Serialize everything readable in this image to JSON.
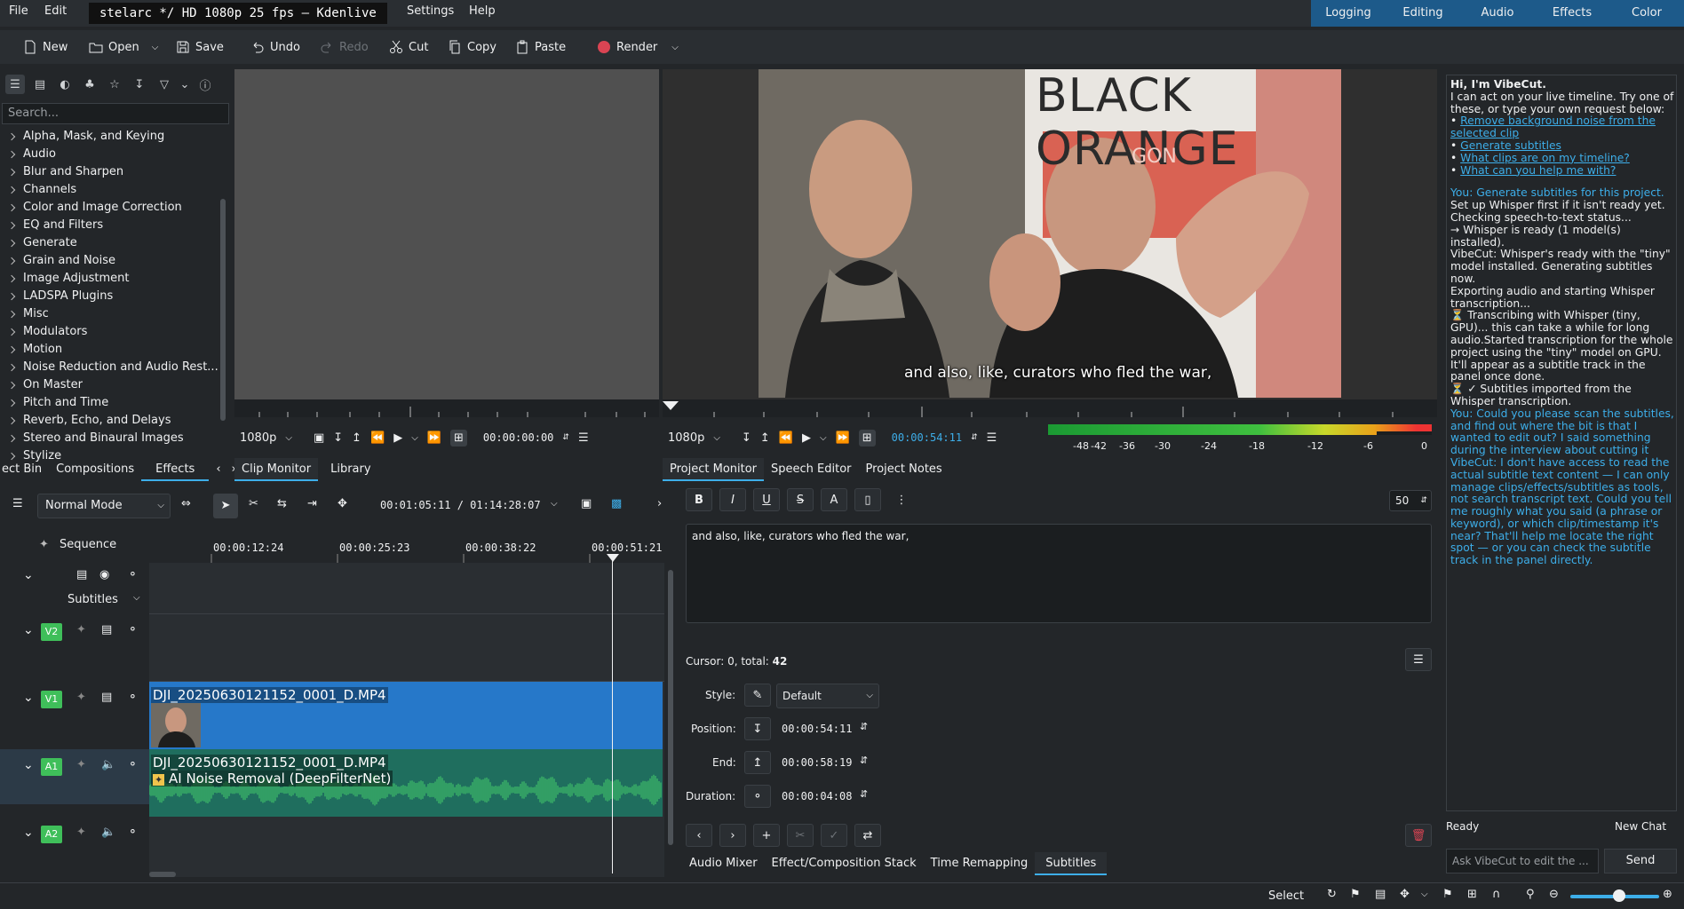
{
  "menu": {
    "items": [
      "File",
      "Edit",
      "Settings",
      "Help"
    ],
    "window_title": "stelarc */ HD 1080p 25 fps — Kdenlive"
  },
  "workspaces": [
    "Logging",
    "Editing",
    "Audio",
    "Effects",
    "Color"
  ],
  "toolbar": {
    "new": "New",
    "open": "Open",
    "save": "Save",
    "undo": "Undo",
    "redo": "Redo",
    "cut": "Cut",
    "copy": "Copy",
    "paste": "Paste",
    "render": "Render"
  },
  "effects": {
    "search_placeholder": "Search...",
    "categories": [
      "Alpha, Mask, and Keying",
      "Audio",
      "Blur and Sharpen",
      "Channels",
      "Color and Image Correction",
      "EQ and Filters",
      "Generate",
      "Grain and Noise",
      "Image Adjustment",
      "LADSPA Plugins",
      "Misc",
      "Modulators",
      "Motion",
      "Noise Reduction and Audio Rest...",
      "On Master",
      "Pitch and Time",
      "Reverb, Echo, and Delays",
      "Stereo and Binaural Images",
      "Stylize"
    ],
    "tabs": [
      "ect Bin",
      "Compositions",
      "Effects"
    ]
  },
  "clip_monitor": {
    "resolution": "1080p",
    "timecode": "00:00:00:00",
    "tabs": [
      "Clip Monitor",
      "Library"
    ]
  },
  "project_monitor": {
    "resolution": "1080p",
    "timecode": "00:00:54:11",
    "subtitle_overlay": "and also, like, curators who fled the war,",
    "sign_text": "BLACK ORANGE",
    "sign_sub": "GON",
    "vu_ticks": [
      "-48",
      "-42",
      "-36",
      "-30",
      "-24",
      "-18",
      "-12",
      "-6",
      "0"
    ],
    "tabs": [
      "Project Monitor",
      "Speech Editor",
      "Project Notes"
    ]
  },
  "timeline": {
    "mode": "Normal Mode",
    "position": "00:01:05:11 / 01:14:28:07",
    "sequence_label": "Sequence",
    "ruler": [
      "00:00:12:24",
      "00:00:25:23",
      "00:00:38:22",
      "00:00:51:21"
    ],
    "subtitles_label": "Subtitles",
    "tracks": [
      "V2",
      "V1",
      "A1",
      "A2"
    ],
    "video_clip_name": "DJI_20250630121152_0001_D.MP4",
    "audio_clip_name": "DJI_20250630121152_0001_D.MP4",
    "audio_effect": "AI Noise Removal (DeepFilterNet)"
  },
  "subtitle_editor": {
    "text": "and also, like, curators who fled the war,",
    "cursor_label": "Cursor: 0, total: ",
    "cursor_total": "42",
    "style_label": "Style:",
    "style_value": "Default",
    "position_label": "Position:",
    "position_value": "00:00:54:11",
    "end_label": "End:",
    "end_value": "00:00:58:19",
    "duration_label": "Duration:",
    "duration_value": "00:00:04:08",
    "font_size": "50",
    "bottom_tabs": [
      "Audio Mixer",
      "Effect/Composition Stack",
      "Time Remapping",
      "Subtitles"
    ]
  },
  "chat": {
    "greeting_title": "Hi, I'm VibeCut.",
    "greeting_body": "I can act on your live timeline. Try one of these, or type your own request below:",
    "suggestions": [
      "Remove background noise from the selected clip",
      "Generate subtitles",
      "What clips are on my timeline?",
      "What can you help me with?"
    ],
    "messages": [
      {
        "who": "you",
        "text": "You: Generate subtitles for this project."
      },
      {
        "who": "vibe",
        "text": "Set up Whisper first if it isn't ready yet. Checking speech-to-text status..."
      },
      {
        "who": "vibe",
        "text": "→ Whisper is ready (1 model(s) installed)."
      },
      {
        "who": "vibe",
        "text": "VibeCut: Whisper's ready with the \"tiny\" model installed. Generating subtitles now."
      },
      {
        "who": "vibe",
        "text": "Exporting audio and starting Whisper transcription..."
      },
      {
        "who": "vibe",
        "text": "⏳ Transcribing with Whisper (tiny, GPU)... this can take a while for long audio.Started transcription for the whole project using the \"tiny\" model on GPU. It'll appear as a subtitle track in the panel once done."
      },
      {
        "who": "vibe",
        "text": "⏳ ✓ Subtitles imported from the Whisper transcription."
      },
      {
        "who": "you",
        "text": "You: Could you please scan the subtitles, and find out where the bit is that I wanted to edit out? I said something during the interview about cutting it"
      },
      {
        "who": "you",
        "text": "VibeCut: I don't have access to read the actual subtitle text content — I can only manage clips/effects/subtitles as tools, not search transcript text. Could you tell me roughly what you said (a phrase or keyword), or which clip/timestamp it's near? That'll help me locate the right spot — or you can check the subtitle track in the panel directly."
      }
    ],
    "status": "Ready",
    "new_chat": "New Chat",
    "input_placeholder": "Ask VibeCut to edit the ...",
    "send": "Send"
  },
  "statusbar": {
    "select": "Select"
  }
}
